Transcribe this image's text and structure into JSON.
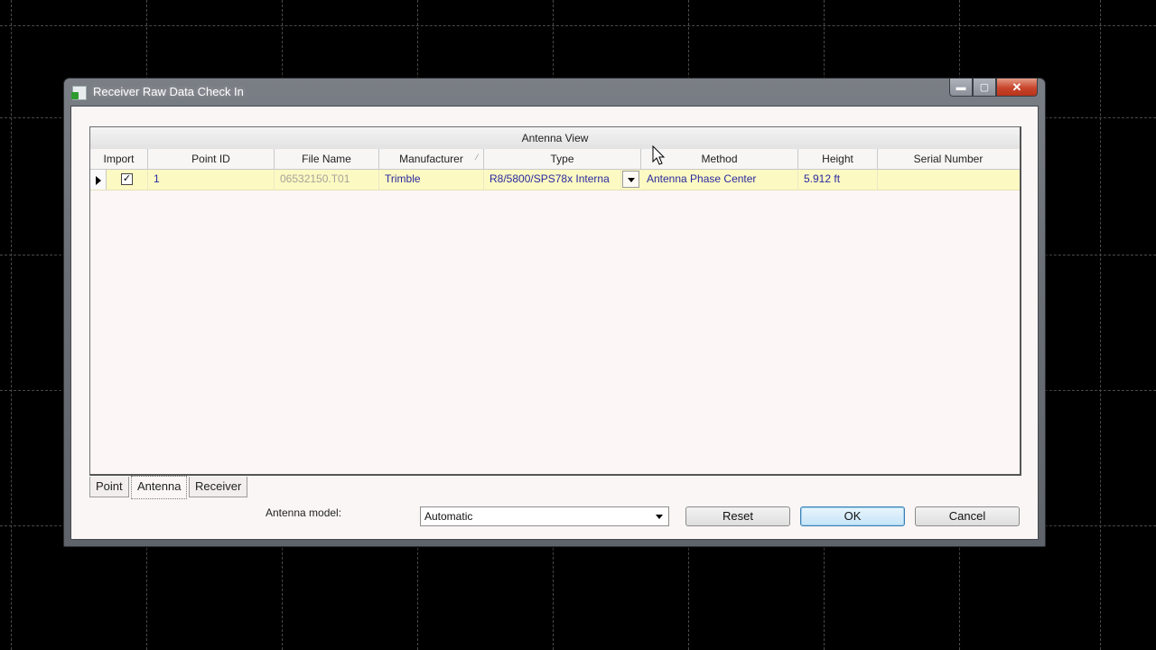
{
  "window": {
    "title": "Receiver Raw Data Check In",
    "minimize_label": "▬",
    "maximize_label": "▢",
    "close_label": "✕"
  },
  "grid": {
    "group_header": "Antenna View",
    "columns": [
      "Import",
      "Point ID",
      "File Name",
      "Manufacturer",
      "Type",
      "Method",
      "Height",
      "Serial Number"
    ],
    "rows": [
      {
        "import_checked": "✓",
        "point_id": "1",
        "file_name": "06532150.T01",
        "manufacturer": "Trimble",
        "type": "R8/5800/SPS78x Interna",
        "method": "Antenna Phase Center",
        "height": "5.912 ft",
        "serial_number": ""
      }
    ]
  },
  "tabs": [
    "Point",
    "Antenna",
    "Receiver"
  ],
  "active_tab": "Antenna",
  "footer": {
    "antenna_model_label": "Antenna model:",
    "antenna_model_value": "Automatic",
    "reset_label": "Reset",
    "ok_label": "OK",
    "cancel_label": "Cancel"
  },
  "colors": {
    "row_highlight": "#fcf9c2",
    "link_text": "#2a2aa0",
    "background": "#000000"
  }
}
